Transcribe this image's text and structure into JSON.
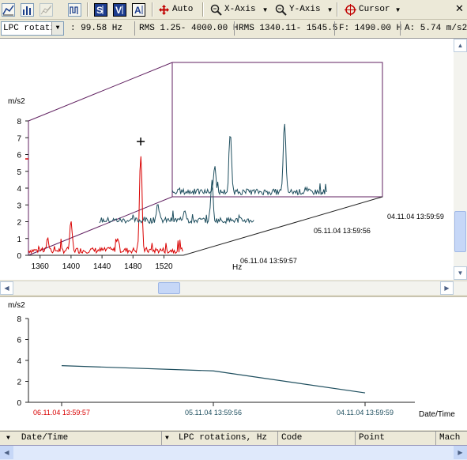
{
  "toolbar": {
    "auto_label": "Auto",
    "xaxis_label": "X-Axis",
    "yaxis_label": "Y-Axis",
    "cursor_label": "Cursor"
  },
  "status": {
    "channel": "LPC rotati",
    "frequency": ": 99.58 Hz",
    "rms1": "RMS 1.25- 4000.00 H",
    "rms2": "RMS 1340.11- 1545.5:",
    "f": "F: 1490.00 H",
    "a": "A: 5.74 m/s2"
  },
  "colors": {
    "red": "#d90000",
    "teal": "#1f4f5f",
    "frame": "#602060",
    "axis": "#202020"
  },
  "chart_data": [
    {
      "type": "line",
      "title": "",
      "ylabel": "m/s2",
      "xlabel": "Hz",
      "y_ticks": [
        "0",
        "1",
        "2",
        "3",
        "4",
        "5",
        "6",
        "7",
        "8"
      ],
      "x_ticks": [
        "1360",
        "1400",
        "1440",
        "1480",
        "1520"
      ],
      "ylim": [
        0,
        8
      ],
      "xlim": [
        1345,
        1545
      ],
      "cursor": {
        "x": 1490,
        "y": 5.74
      },
      "series": [
        {
          "name": "06.11.04 13:59:57",
          "color": "red",
          "peaks": [
            [
              1400,
              1.6
            ],
            [
              1490,
              5.74
            ],
            [
              1460,
              0.8
            ],
            [
              1370,
              0.6
            ]
          ]
        },
        {
          "name": "05.11.04 13:59:56",
          "color": "teal",
          "peaks": [
            [
              1420,
              1.0
            ],
            [
              1490,
              2.3
            ],
            [
              1455,
              0.7
            ]
          ]
        },
        {
          "name": "04.11.04 13:59:59",
          "color": "teal",
          "peaks": [
            [
              1400,
              1.5
            ],
            [
              1420,
              3.4
            ],
            [
              1490,
              4.2
            ]
          ]
        }
      ]
    },
    {
      "type": "line",
      "title": "",
      "ylabel": "m/s2",
      "xlabel": "Date/Time",
      "y_ticks": [
        "0",
        "2",
        "4",
        "6",
        "8"
      ],
      "ylim": [
        0,
        8
      ],
      "categories": [
        "06.11.04 13:59:57",
        "05.11.04 13:59:56",
        "04.11.04 13:59:59"
      ],
      "values": [
        3.5,
        3.0,
        0.9
      ]
    }
  ],
  "grid": {
    "columns": [
      "Date/Time",
      "LPC rotations, Hz",
      "Code",
      "Point",
      "Mach"
    ]
  }
}
